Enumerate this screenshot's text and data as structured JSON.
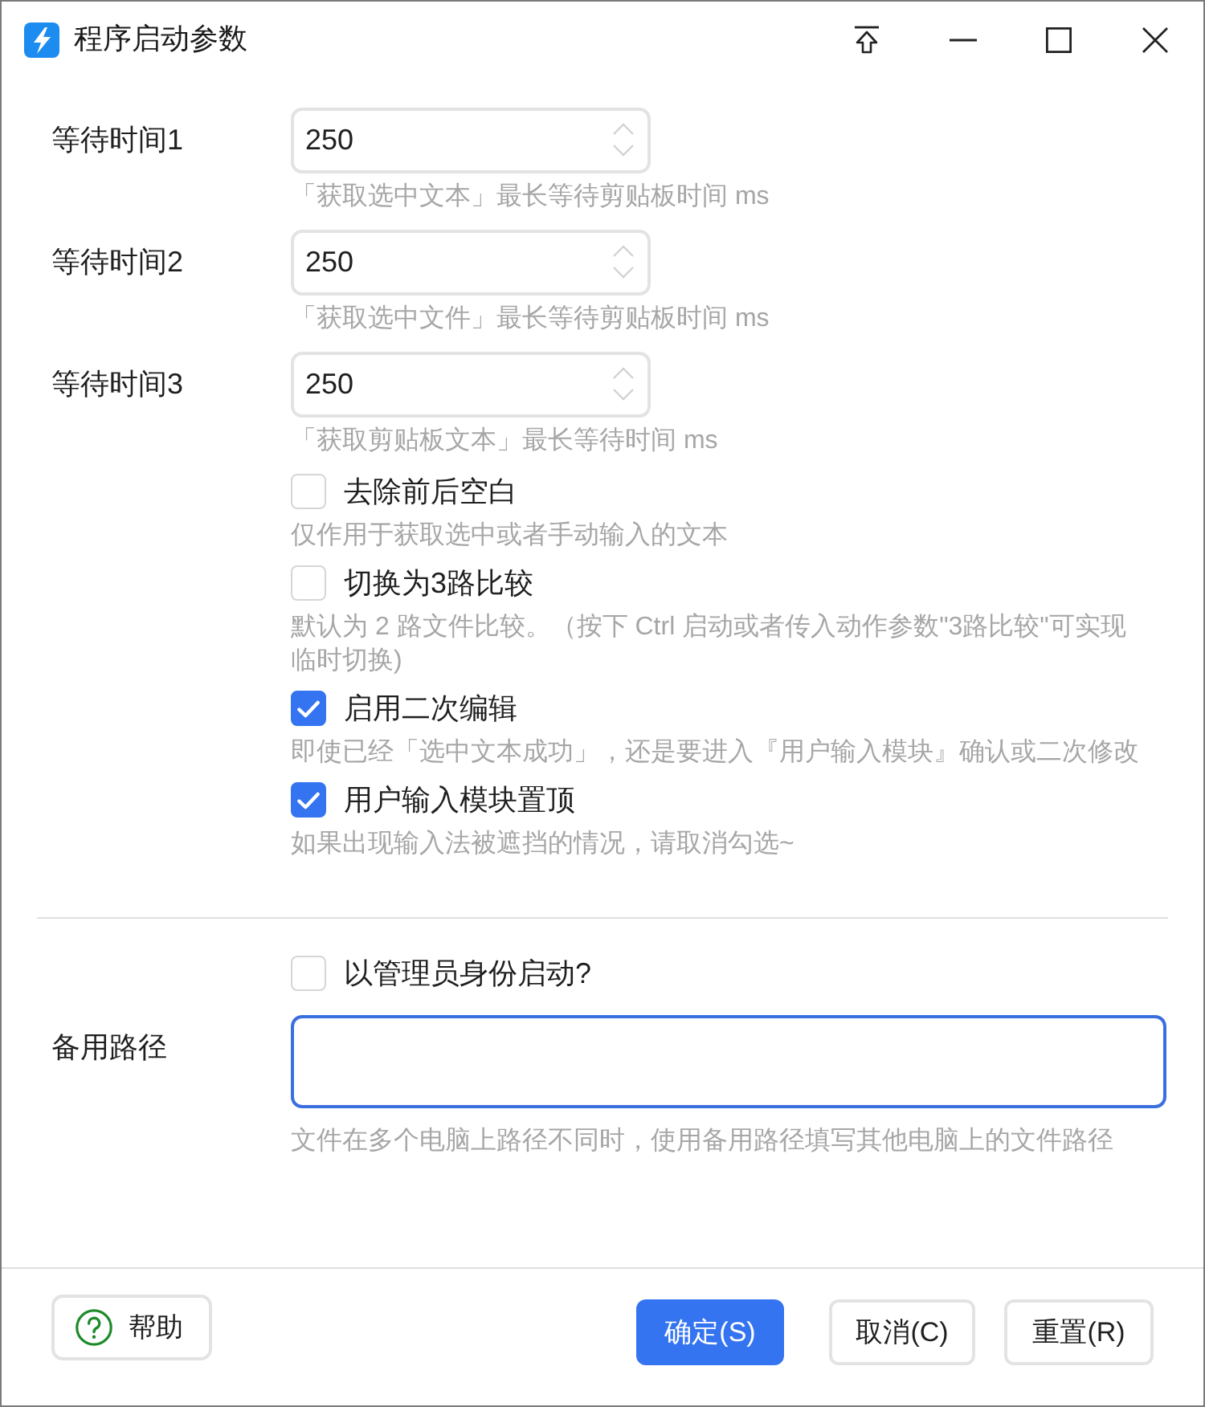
{
  "window": {
    "title": "程序启动参数"
  },
  "wait_times": [
    {
      "label": "等待时间1",
      "value": "250",
      "hint": "「获取选中文本」最长等待剪贴板时间 ms"
    },
    {
      "label": "等待时间2",
      "value": "250",
      "hint": "「获取选中文件」最长等待剪贴板时间 ms"
    },
    {
      "label": "等待时间3",
      "value": "250",
      "hint": "「获取剪贴板文本」最长等待时间 ms"
    }
  ],
  "options": [
    {
      "label": "去除前后空白",
      "checked": false,
      "hint": "仅作用于获取选中或者手动输入的文本"
    },
    {
      "label": "切换为3路比较",
      "checked": false,
      "hint": "默认为 2 路文件比较。（按下 Ctrl 启动或者传入动作参数\"3路比较\"可实现临时切换)"
    },
    {
      "label": "启用二次编辑",
      "checked": true,
      "hint": "即使已经「选中文本成功」，还是要进入『用户输入模块』确认或二次修改"
    },
    {
      "label": "用户输入模块置顶",
      "checked": true,
      "hint": "如果出现输入法被遮挡的情况，请取消勾选~"
    }
  ],
  "run_as_admin": {
    "label": "以管理员身份启动?",
    "checked": false
  },
  "backup_path": {
    "label": "备用路径",
    "focused": true,
    "hint": "文件在多个电脑上路径不同时，使用备用路径填写其他电脑上的文件路径"
  },
  "footer": {
    "help_button": "帮助",
    "buttons": [
      {
        "label": "确定(S)",
        "primary": true
      },
      {
        "label": "取消(C)",
        "primary": false
      },
      {
        "label": "重置(R)",
        "primary": false
      }
    ]
  }
}
